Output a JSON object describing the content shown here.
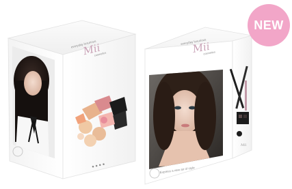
{
  "badge": {
    "label": "NEW",
    "color": "#f2a6c8"
  },
  "box_left": {
    "brand": "Mii",
    "tagline_top": "everyday luxurious",
    "tagline_bottom": "cosmetics",
    "footer_dots": "● ● ● ●"
  },
  "box_right": {
    "brand": "Mii",
    "tagline_top": "everyday luxurious",
    "tagline_bottom": "cosmetics",
    "caption": "Express a new air of style",
    "side_label": "Mii"
  },
  "colors": {
    "brand_accent": "#c9a2b6",
    "box_white": "#ffffff",
    "box_shadow": "#e6e6e6"
  }
}
